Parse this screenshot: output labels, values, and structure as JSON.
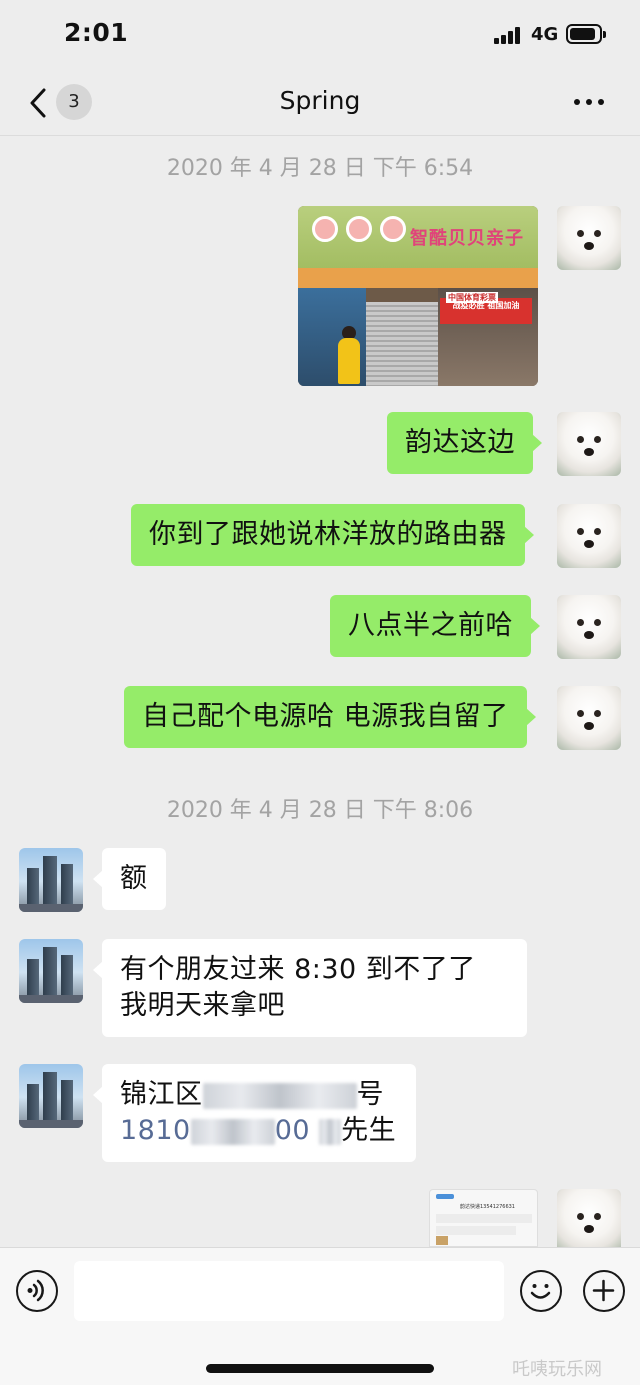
{
  "status_bar": {
    "time": "2:01",
    "network": "4G",
    "battery_level": 0.9
  },
  "nav": {
    "back_icon": "chevron-left-icon",
    "unread_count": "3",
    "title": "Spring",
    "more_icon": "more-dots-icon"
  },
  "timestamps": [
    "2020 年 4 月 28 日  下午 6:54",
    "2020 年 4 月 28 日  下午 8:06"
  ],
  "photo": {
    "shop_sign": "智酷贝贝亲子",
    "banner_title": "中国体育彩票",
    "banner_text": "战疫必胜  祖国加油"
  },
  "messages": [
    {
      "text": "韵达这边"
    },
    {
      "text": "你到了跟她说林洋放的路由器"
    },
    {
      "text": "八点半之前哈"
    },
    {
      "text": "自己配个电源哈 电源我自留了"
    },
    {
      "text": "额"
    },
    {
      "text": "有个朋友过来 8:30 到不了了 我明天来拿吧"
    },
    {
      "addr_prefix": "锦江区",
      "addr_suffix": "号",
      "phone_prefix": "1810",
      "phone_suffix": "00",
      "name_suffix": "先生"
    }
  ],
  "screenshot": {
    "title": "韵达快递13541276631"
  },
  "input_bar": {
    "voice_icon": "voice-icon",
    "emoji_icon": "emoji-icon",
    "plus_icon": "plus-icon",
    "placeholder": ""
  },
  "watermark": "吒咦玩乐网"
}
